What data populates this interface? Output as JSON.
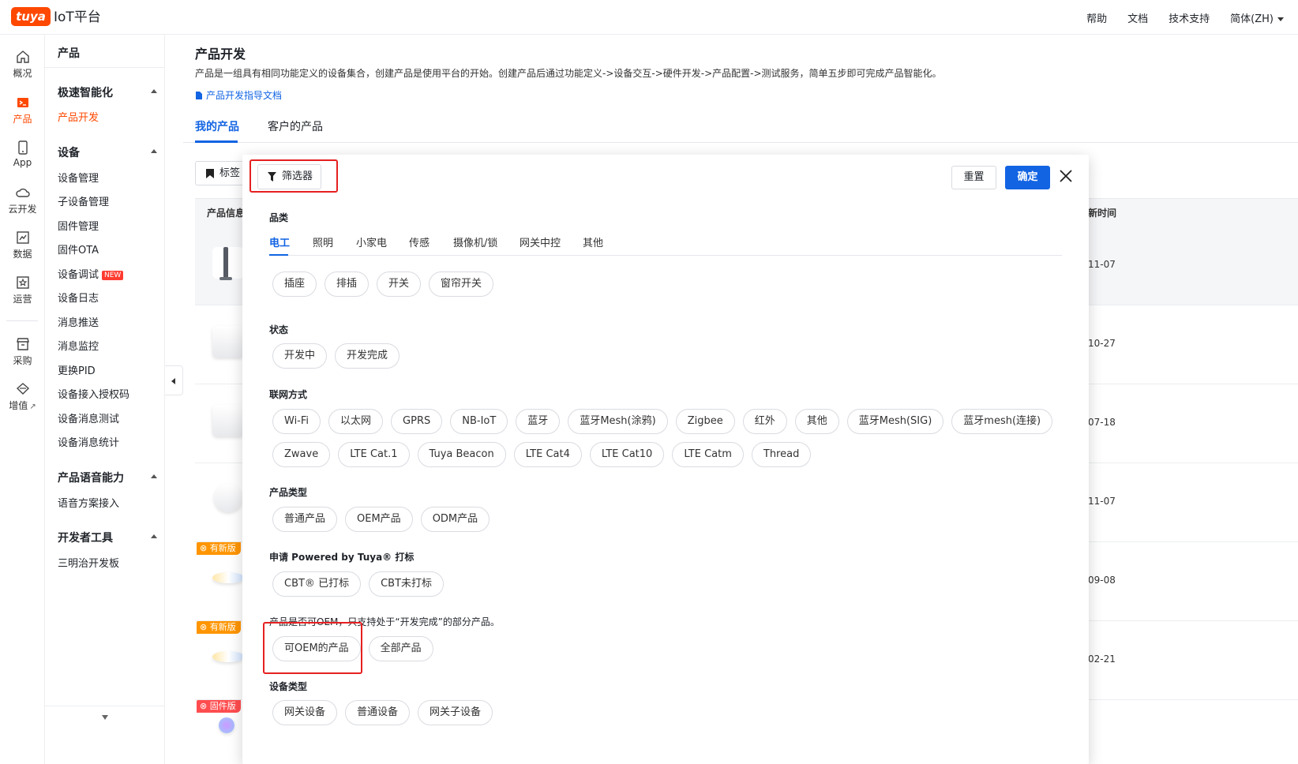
{
  "topbar": {
    "logo_badge": "tuya",
    "logo_text": "IoT平台",
    "links": [
      "帮助",
      "文档",
      "技术支持",
      "简体(ZH)"
    ]
  },
  "rail": {
    "items": [
      {
        "label": "概况",
        "icon": "home-icon"
      },
      {
        "label": "产品",
        "icon": "terminal-icon"
      },
      {
        "label": "App",
        "icon": "phone-icon"
      },
      {
        "label": "云开发",
        "icon": "cloud-icon"
      },
      {
        "label": "数据",
        "icon": "chart-icon"
      },
      {
        "label": "运营",
        "icon": "star-icon"
      },
      {
        "label": "采购",
        "icon": "shop-icon"
      },
      {
        "label": "增值",
        "icon": "diamond-icon"
      }
    ]
  },
  "sidebar": {
    "title": "产品",
    "groups": [
      {
        "label": "极速智能化",
        "items": [
          "产品开发"
        ]
      },
      {
        "label": "设备",
        "items": [
          "设备管理",
          "子设备管理",
          "固件管理",
          "固件OTA",
          "设备调试",
          "设备日志",
          "消息推送",
          "消息监控",
          "更换PID",
          "设备接入授权码",
          "设备消息测试",
          "设备消息统计"
        ]
      },
      {
        "label": "产品语音能力",
        "items": [
          "语音方案接入"
        ]
      },
      {
        "label": "开发者工具",
        "items": [
          "三明治开发板"
        ]
      }
    ],
    "new_badge": "NEW"
  },
  "main": {
    "title": "产品开发",
    "description": "产品是一组具有相同功能定义的设备集合，创建产品是使用平台的开始。创建产品后通过功能定义->设备交互->硬件开发->产品配置->测试服务，简单五步即可完成产品智能化。",
    "guide_link": "产品开发指导文档",
    "tabs": [
      "我的产品",
      "客户的产品"
    ],
    "tag_button": "标签",
    "table": {
      "col_info": "产品信息",
      "col_time": "新时间",
      "rows": [
        {
          "date": "11-07",
          "badge": ""
        },
        {
          "date": "10-27",
          "badge": ""
        },
        {
          "date": "07-18",
          "badge": ""
        },
        {
          "date": "11-07",
          "badge": ""
        },
        {
          "date": "09-08",
          "badge": "有新版"
        },
        {
          "date": "02-21",
          "badge": "有新版"
        },
        {
          "date": "",
          "badge": "固件版"
        }
      ]
    }
  },
  "filter": {
    "filter_button": "筛选器",
    "reset": "重置",
    "confirm": "确定",
    "category": {
      "label": "品类",
      "tabs": [
        "电工",
        "照明",
        "小家电",
        "传感",
        "摄像机/锁",
        "网关中控",
        "其他"
      ],
      "chips": [
        "插座",
        "排插",
        "开关",
        "窗帘开关"
      ]
    },
    "status": {
      "label": "状态",
      "chips": [
        "开发中",
        "开发完成"
      ]
    },
    "network": {
      "label": "联网方式",
      "row1": [
        "Wi-Fi",
        "以太网",
        "GPRS",
        "NB-IoT",
        "蓝牙",
        "蓝牙Mesh(涂鸦)",
        "Zigbee",
        "红外",
        "其他",
        "蓝牙Mesh(SIG)",
        "蓝牙mesh(连接)"
      ],
      "row2": [
        "Zwave",
        "LTE Cat.1",
        "Tuya Beacon",
        "LTE Cat4",
        "LTE Cat10",
        "LTE Catm",
        "Thread"
      ]
    },
    "product_type": {
      "label": "产品类型",
      "chips": [
        "普通产品",
        "OEM产品",
        "ODM产品"
      ]
    },
    "powered": {
      "label": "申请 Powered by Tuya® 打标",
      "chips": [
        "CBT® 已打标",
        "CBT未打标"
      ]
    },
    "oem": {
      "label": "产品是否可OEM，只支持处于“开发完成”的部分产品。",
      "chips": [
        "可OEM的产品",
        "全部产品"
      ]
    },
    "device_type": {
      "label": "设备类型",
      "chips": [
        "网关设备",
        "普通设备",
        "网关子设备"
      ]
    }
  },
  "colors": {
    "brand": "#ff4800",
    "accent": "#1264e3",
    "highlight": "#e62020"
  }
}
